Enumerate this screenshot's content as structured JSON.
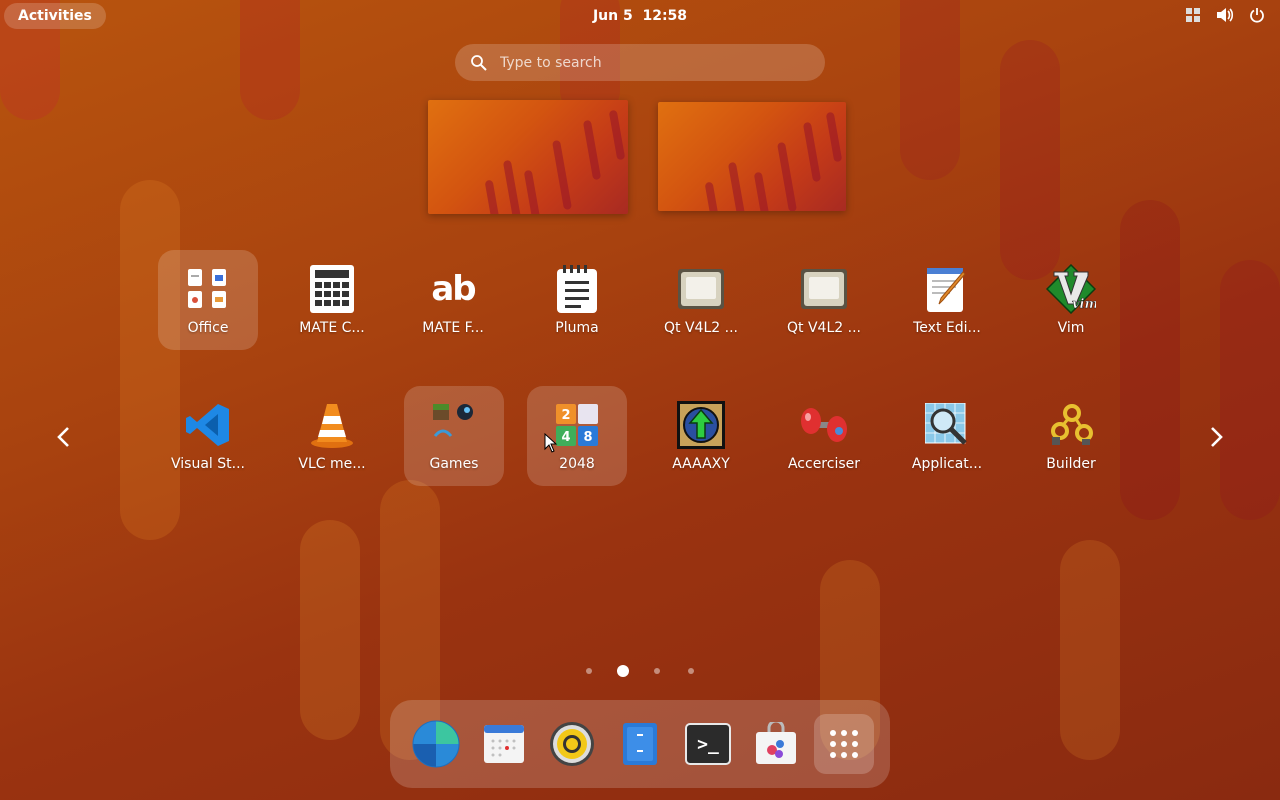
{
  "topbar": {
    "activities_label": "Activities",
    "date": "Jun 5",
    "time": "12:58",
    "tray_icons": [
      "keyboard-layout-icon",
      "volume-icon",
      "power-icon"
    ]
  },
  "search": {
    "placeholder": "Type to search"
  },
  "app_grid": {
    "rows": [
      [
        {
          "label": "Office",
          "icon": "office-folder-icon",
          "selected": true
        },
        {
          "label": "MATE C...",
          "icon": "calculator-icon"
        },
        {
          "label": "MATE F...",
          "icon": "font-viewer-icon"
        },
        {
          "label": "Pluma",
          "icon": "notepad-icon"
        },
        {
          "label": "Qt V4L2 ...",
          "icon": "webcam-icon"
        },
        {
          "label": "Qt V4L2 ...",
          "icon": "webcam-icon"
        },
        {
          "label": "Text Edi...",
          "icon": "text-editor-icon"
        },
        {
          "label": "Vim",
          "icon": "vim-icon"
        }
      ],
      [
        {
          "label": "Visual St...",
          "icon": "vscode-icon"
        },
        {
          "label": "VLC me...",
          "icon": "vlc-cone-icon"
        },
        {
          "label": "Games",
          "icon": "games-folder-icon",
          "selected": true
        },
        {
          "label": "2048",
          "icon": "2048-icon",
          "selected": true
        },
        {
          "label": "AAAAXY",
          "icon": "aaaaxy-icon"
        },
        {
          "label": "Accerciser",
          "icon": "accerciser-icon"
        },
        {
          "label": "Applicat...",
          "icon": "magnifier-icon"
        },
        {
          "label": "Builder",
          "icon": "builder-icon"
        }
      ]
    ],
    "tile_2048": [
      "2",
      "",
      "4",
      "8"
    ],
    "vim_letter": "vim",
    "font_viewer_text": "ab"
  },
  "pagination": {
    "pages": 4,
    "current": 2
  },
  "dock": {
    "items": [
      "browser-globe-icon",
      "calendar-icon",
      "rhythmbox-icon",
      "files-icon",
      "terminal-icon",
      "software-bag-icon",
      "show-apps-grid-icon"
    ],
    "terminal_prompt": ">_"
  },
  "colors": {
    "bg_orange": "#b8540e",
    "bg_red": "#8a2a10",
    "accent_white": "#ffffff"
  }
}
